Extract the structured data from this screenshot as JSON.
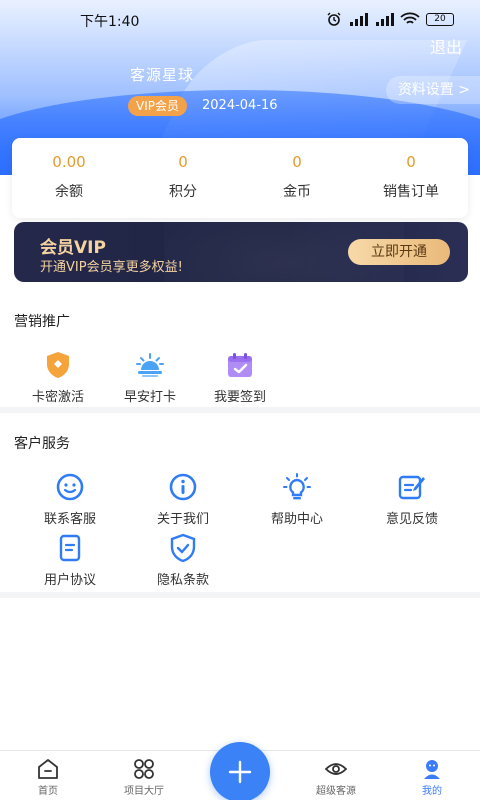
{
  "status_bar": {
    "time": "下午1:40",
    "battery": "20"
  },
  "header": {
    "logout_label": "退出",
    "username": "客源星球",
    "vip_badge": "VIP会员",
    "vip_expiry": "2024-04-16",
    "settings_label": "资料设置 >"
  },
  "stats": [
    {
      "value": "0.00",
      "label": "余额"
    },
    {
      "value": "0",
      "label": "积分"
    },
    {
      "value": "0",
      "label": "金币"
    },
    {
      "value": "0",
      "label": "销售订单"
    }
  ],
  "vip_banner": {
    "title": "会员VIP",
    "subtitle": "开通VIP会员享更多权益!",
    "button_label": "立即开通"
  },
  "marketing": {
    "title": "营销推广",
    "items": [
      {
        "label": "卡密激活",
        "icon": "shield-icon"
      },
      {
        "label": "早安打卡",
        "icon": "sunrise-icon"
      },
      {
        "label": "我要签到",
        "icon": "calendar-check-icon"
      }
    ]
  },
  "service": {
    "title": "客户服务",
    "items": [
      {
        "label": "联系客服",
        "icon": "smile-icon"
      },
      {
        "label": "关于我们",
        "icon": "info-icon"
      },
      {
        "label": "帮助中心",
        "icon": "lightbulb-icon"
      },
      {
        "label": "意见反馈",
        "icon": "feedback-icon"
      },
      {
        "label": "用户协议",
        "icon": "document-icon"
      },
      {
        "label": "隐私条款",
        "icon": "privacy-shield-icon"
      }
    ]
  },
  "bottom_nav": {
    "items": [
      {
        "label": "首页",
        "icon": "home-icon"
      },
      {
        "label": "项目大厅",
        "icon": "grid-icon"
      },
      {
        "label": "超级客源",
        "icon": "eye-icon"
      },
      {
        "label": "我的",
        "icon": "user-icon"
      }
    ],
    "active_index": 3,
    "fab_icon": "plus-icon"
  },
  "colors": {
    "accent": "#3b82f6",
    "stat_value": "#e59b2a",
    "vip_gold": "#f5d3a0",
    "badge_orange": "#f3a24a"
  }
}
